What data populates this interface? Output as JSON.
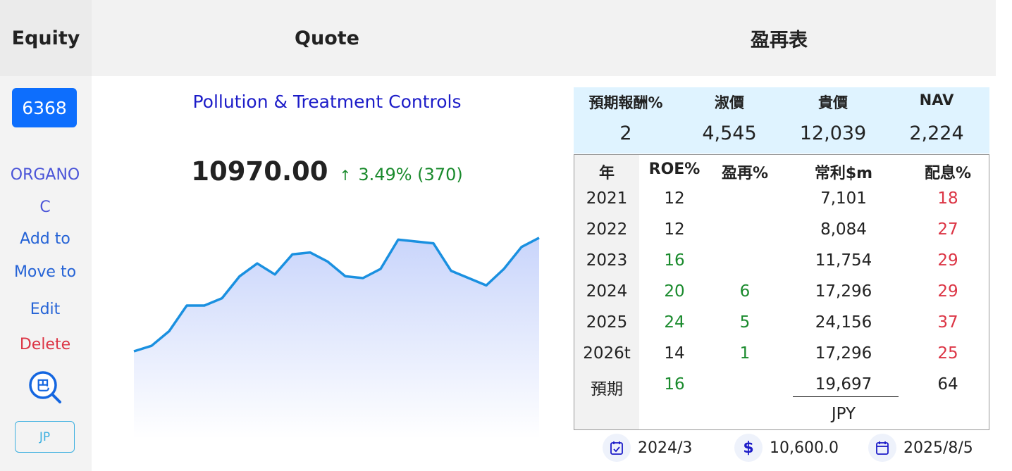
{
  "header": {
    "equity": "Equity",
    "quote": "Quote",
    "table": "盈再表"
  },
  "sidebar": {
    "ticker": "6368",
    "name_line1": "ORGANO",
    "name_line2": "C",
    "add": "Add to",
    "move": "Move to",
    "edit": "Edit",
    "delete": "Delete",
    "ba_icon_char": "巴",
    "region": "JP"
  },
  "quote": {
    "industry": "Pollution & Treatment Controls",
    "price": "10970.00",
    "arrow": "↑",
    "change": "3.49% (370)"
  },
  "chart_data": {
    "type": "area",
    "values": [
      10350,
      10380,
      10460,
      10600,
      10600,
      10640,
      10760,
      10830,
      10770,
      10880,
      10890,
      10840,
      10760,
      10750,
      10800,
      10960,
      10950,
      10940,
      10790,
      10750,
      10710,
      10800,
      10920,
      10970
    ],
    "ylim": [
      9900,
      11000
    ],
    "colors": {
      "line": "#1a90e0",
      "fill_top": "#c9d5fb",
      "fill_bottom": "#ffffff"
    }
  },
  "summary": {
    "labels": [
      "預期報酬%",
      "淑價",
      "貴價",
      "NAV"
    ],
    "values": [
      "2",
      "4,545",
      "12,039",
      "2,224"
    ]
  },
  "table": {
    "headers": [
      "年",
      "ROE%",
      "盈再%",
      "常利$m",
      "配息%"
    ],
    "rows": [
      {
        "year": "2021",
        "roe": "12",
        "roe_c": "black",
        "gr": "",
        "gr_c": "black",
        "profit": "7,101",
        "div": "18",
        "div_c": "red"
      },
      {
        "year": "2022",
        "roe": "12",
        "roe_c": "black",
        "gr": "",
        "gr_c": "black",
        "profit": "8,084",
        "div": "27",
        "div_c": "red"
      },
      {
        "year": "2023",
        "roe": "16",
        "roe_c": "green",
        "gr": "",
        "gr_c": "black",
        "profit": "11,754",
        "div": "29",
        "div_c": "red"
      },
      {
        "year": "2024",
        "roe": "20",
        "roe_c": "green",
        "gr": "6",
        "gr_c": "green",
        "profit": "17,296",
        "div": "29",
        "div_c": "red"
      },
      {
        "year": "2025",
        "roe": "24",
        "roe_c": "green",
        "gr": "5",
        "gr_c": "green",
        "profit": "24,156",
        "div": "37",
        "div_c": "red"
      },
      {
        "year": "2026t",
        "roe": "14",
        "roe_c": "black",
        "gr": "1",
        "gr_c": "green",
        "profit": "17,296",
        "div": "25",
        "div_c": "red"
      },
      {
        "year": "預期",
        "roe": "16",
        "roe_c": "green",
        "gr": "",
        "gr_c": "black",
        "profit": "19,697",
        "div": "64",
        "div_c": "black"
      }
    ],
    "currency": "JPY"
  },
  "footer": {
    "report_date": "2024/3",
    "dollar_icon": "$",
    "amount": "10,600.0",
    "next_date": "2025/8/5"
  }
}
